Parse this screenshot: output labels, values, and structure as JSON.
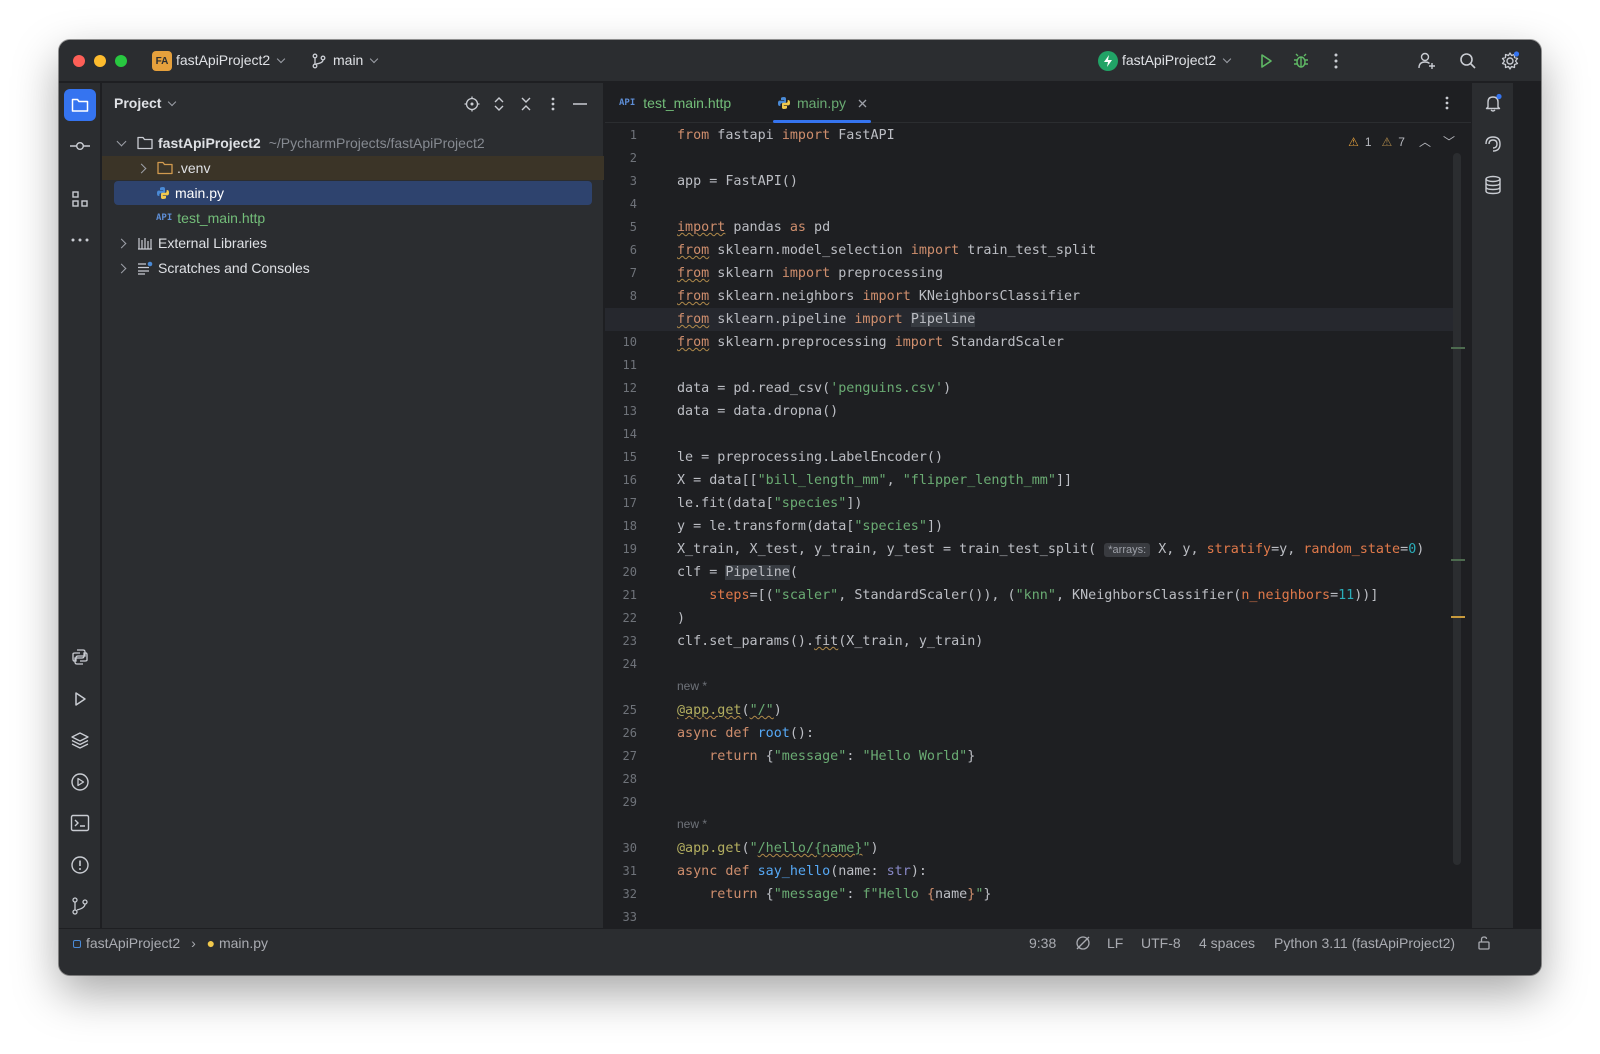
{
  "titlebar": {
    "project_badge": "FA",
    "project_name": "fastApiProject2",
    "branch": "main",
    "run_config": "fastApiProject2"
  },
  "project_panel": {
    "title": "Project",
    "tree": [
      {
        "label": "fastApiProject2",
        "path": "~/PycharmProjects/fastApiProject2"
      },
      {
        "label": ".venv"
      },
      {
        "label": "main.py"
      },
      {
        "label": "test_main.http",
        "badge": "API"
      },
      {
        "label": "External Libraries"
      },
      {
        "label": "Scratches and Consoles"
      }
    ]
  },
  "tabs": [
    {
      "label": "test_main.http",
      "badge": "API"
    },
    {
      "label": "main.py"
    }
  ],
  "inspections": {
    "warnings_1": "1",
    "warnings_2": "7"
  },
  "gutter_hint": "new *",
  "statusbar": {
    "breadcrumb_project": "fastApiProject2",
    "breadcrumb_file": "main.py",
    "position": "9:38",
    "line_sep": "LF",
    "encoding": "UTF-8",
    "indent": "4 spaces",
    "interpreter": "Python 3.11 (fastApiProject2)"
  },
  "colors": {
    "accent": "#3574f0",
    "keyword": "#cf8e6d",
    "string": "#6aab73",
    "number": "#2aacb8",
    "function": "#56a8f5"
  },
  "icons": [
    "folder-icon",
    "commit-icon",
    "structure-icon",
    "more-icon",
    "python-console-icon",
    "run-icon",
    "layers-icon",
    "services-icon",
    "terminal-icon",
    "problems-icon",
    "git-icon",
    "bell-icon",
    "ai-assistant-icon",
    "database-icon",
    "search-icon",
    "settings-icon",
    "add-user-icon",
    "debug-icon"
  ]
}
